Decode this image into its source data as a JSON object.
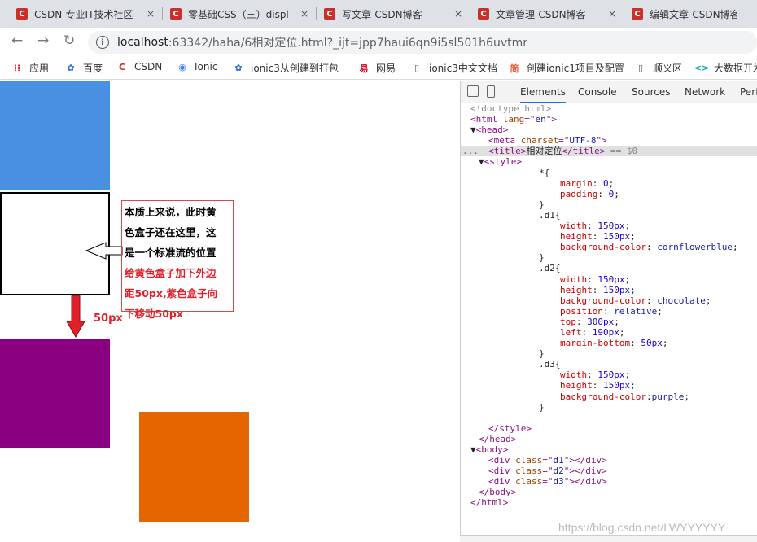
{
  "tabs": [
    {
      "title": "CSDN-专业IT技术社区",
      "fav": "C",
      "close": "×"
    },
    {
      "title": "零基础CSS（三）displ",
      "fav": "C",
      "close": "×"
    },
    {
      "title": "写文章-CSDN博客",
      "fav": "C",
      "close": "×"
    },
    {
      "title": "文章管理-CSDN博客",
      "fav": "C",
      "close": "×"
    },
    {
      "title": "编辑文章-CSDN博客",
      "fav": "C",
      "close": ""
    }
  ],
  "address": {
    "host": "localhost",
    "path": ":63342/haha/6相对定位.html?_ijt=jpp7haui6qn9i5sl501h6uvtmr"
  },
  "nav_icons": {
    "back": "←",
    "forward": "→",
    "reload": "↻",
    "info": "i"
  },
  "bookmarks": [
    {
      "label": "应用",
      "icon": "apps-grid-icon",
      "glyph": "⁞⁞",
      "color": "#e0202a"
    },
    {
      "label": "百度",
      "icon": "baidu-paw-icon",
      "glyph": "✿",
      "color": "#2a6ad8"
    },
    {
      "label": "CSDN",
      "icon": "csdn-icon",
      "glyph": "C",
      "color": "#c9302c"
    },
    {
      "label": "Ionic",
      "icon": "ionic-icon",
      "glyph": "◉",
      "color": "#3880ff"
    },
    {
      "label": "ionic3从创建到打包",
      "icon": "baidu-paw-icon",
      "glyph": "✿",
      "color": "#2a6ad8"
    },
    {
      "label": "网易",
      "icon": "netease-icon",
      "glyph": "易",
      "color": "#d0021b"
    },
    {
      "label": "ionic3中文文档",
      "icon": "document-icon",
      "glyph": "▯",
      "color": "#555"
    },
    {
      "label": "创建ionic1项目及配置",
      "icon": "jianshu-icon",
      "glyph": "简",
      "color": "#e06040"
    },
    {
      "label": "顺义区",
      "icon": "document-icon",
      "glyph": "▯",
      "color": "#555"
    },
    {
      "label": "大数据开发",
      "icon": "code-icon",
      "glyph": "<>",
      "color": "#00a8a8"
    }
  ],
  "annotation": {
    "black_lines": [
      "本质上来说，此时黄",
      "色盒子还在这里，这",
      "是一个标准流的位置"
    ],
    "red_lines": [
      "给黄色盒子加下外边",
      "距50px,紫色盒子向",
      "下移动50px"
    ],
    "offset_label": "50px"
  },
  "colors": {
    "d1": "#4a90e2",
    "d2": "#e56500",
    "d3": "#8b0080",
    "annotation_red": "#e0202a"
  },
  "devtools": {
    "tabs": [
      "Elements",
      "Console",
      "Sources",
      "Network",
      "Perfo"
    ],
    "active_tab": "Elements",
    "code_lines": [
      [
        [
          "cmt",
          "<!doctype html>"
        ]
      ],
      [
        [
          "tag",
          "<html "
        ],
        [
          "attr",
          "lang"
        ],
        [
          "tag",
          "=\""
        ],
        [
          "val",
          "en"
        ],
        [
          "tag",
          "\">"
        ]
      ],
      [
        [
          "txt",
          "▼"
        ],
        [
          "tag",
          "<head>"
        ]
      ],
      [
        [
          "tag",
          "<meta "
        ],
        [
          "attr",
          "charset"
        ],
        [
          "tag",
          "=\""
        ],
        [
          "val",
          "UTF-8"
        ],
        [
          "tag",
          "\">"
        ]
      ],
      [
        [
          "tag",
          "<title>"
        ],
        [
          "txt",
          "相对定位"
        ],
        [
          "tag",
          "</title>"
        ],
        [
          "cmt",
          " == $0"
        ]
      ],
      [
        [
          "txt",
          "▼"
        ],
        [
          "tag",
          "<style>"
        ]
      ],
      [
        [
          "txt",
          "*{"
        ]
      ],
      [
        [
          "prop",
          "margin"
        ],
        [
          "txt",
          ": "
        ],
        [
          "num",
          "0"
        ],
        [
          "txt",
          ";"
        ]
      ],
      [
        [
          "prop",
          "padding"
        ],
        [
          "txt",
          ": "
        ],
        [
          "num",
          "0"
        ],
        [
          "txt",
          ";"
        ]
      ],
      [
        [
          "txt",
          "}"
        ]
      ],
      [
        [
          "txt",
          ".d1{"
        ]
      ],
      [
        [
          "prop",
          "width"
        ],
        [
          "txt",
          ": "
        ],
        [
          "num",
          "150px"
        ],
        [
          "txt",
          ";"
        ]
      ],
      [
        [
          "prop",
          "height"
        ],
        [
          "txt",
          ": "
        ],
        [
          "num",
          "150px"
        ],
        [
          "txt",
          ";"
        ]
      ],
      [
        [
          "prop",
          "background-color"
        ],
        [
          "txt",
          ": "
        ],
        [
          "val",
          "cornflowerblue"
        ],
        [
          "txt",
          ";"
        ]
      ],
      [
        [
          "txt",
          "}"
        ]
      ],
      [
        [
          "txt",
          ".d2{"
        ]
      ],
      [
        [
          "prop",
          "width"
        ],
        [
          "txt",
          ": "
        ],
        [
          "num",
          "150px"
        ],
        [
          "txt",
          ";"
        ]
      ],
      [
        [
          "prop",
          "height"
        ],
        [
          "txt",
          ": "
        ],
        [
          "num",
          "150px"
        ],
        [
          "txt",
          ";"
        ]
      ],
      [
        [
          "prop",
          "background-color"
        ],
        [
          "txt",
          ": "
        ],
        [
          "val",
          "chocolate"
        ],
        [
          "txt",
          ";"
        ]
      ],
      [
        [
          "prop",
          "position"
        ],
        [
          "txt",
          ": "
        ],
        [
          "val",
          "relative"
        ],
        [
          "txt",
          ";"
        ]
      ],
      [
        [
          "prop",
          "top"
        ],
        [
          "txt",
          ": "
        ],
        [
          "num",
          "300px"
        ],
        [
          "txt",
          ";"
        ]
      ],
      [
        [
          "prop",
          "left"
        ],
        [
          "txt",
          ": "
        ],
        [
          "num",
          "190px"
        ],
        [
          "txt",
          ";"
        ]
      ],
      [
        [
          "prop",
          "margin-bottom"
        ],
        [
          "txt",
          ": "
        ],
        [
          "num",
          "50px"
        ],
        [
          "txt",
          ";"
        ]
      ],
      [
        [
          "txt",
          "}"
        ]
      ],
      [
        [
          "txt",
          ".d3{"
        ]
      ],
      [
        [
          "prop",
          "width"
        ],
        [
          "txt",
          ": "
        ],
        [
          "num",
          "150px"
        ],
        [
          "txt",
          ";"
        ]
      ],
      [
        [
          "prop",
          "height"
        ],
        [
          "txt",
          ": "
        ],
        [
          "num",
          "150px"
        ],
        [
          "txt",
          ";"
        ]
      ],
      [
        [
          "prop",
          "background-color"
        ],
        [
          "txt",
          ":"
        ],
        [
          "val",
          "purple"
        ],
        [
          "txt",
          ";"
        ]
      ],
      [
        [
          "txt",
          "}"
        ]
      ],
      [
        [
          "txt",
          ""
        ]
      ],
      [
        [
          "tag",
          "</style>"
        ]
      ],
      [
        [
          "tag",
          "</head>"
        ]
      ],
      [
        [
          "txt",
          "▼"
        ],
        [
          "tag",
          "<body>"
        ]
      ],
      [
        [
          "tag",
          "<div "
        ],
        [
          "attr",
          "class"
        ],
        [
          "tag",
          "=\""
        ],
        [
          "val",
          "d1"
        ],
        [
          "tag",
          "\"></div>"
        ]
      ],
      [
        [
          "tag",
          "<div "
        ],
        [
          "attr",
          "class"
        ],
        [
          "tag",
          "=\""
        ],
        [
          "val",
          "d2"
        ],
        [
          "tag",
          "\"></div>"
        ]
      ],
      [
        [
          "tag",
          "<div "
        ],
        [
          "attr",
          "class"
        ],
        [
          "tag",
          "=\""
        ],
        [
          "val",
          "d3"
        ],
        [
          "tag",
          "\"></div>"
        ]
      ],
      [
        [
          "tag",
          "</body>"
        ]
      ],
      [
        [
          "tag",
          "</html>"
        ]
      ]
    ],
    "selected_dots": "...",
    "triangle_open": "▼"
  },
  "watermark": "https://blog.csdn.net/LWYYYYYY"
}
